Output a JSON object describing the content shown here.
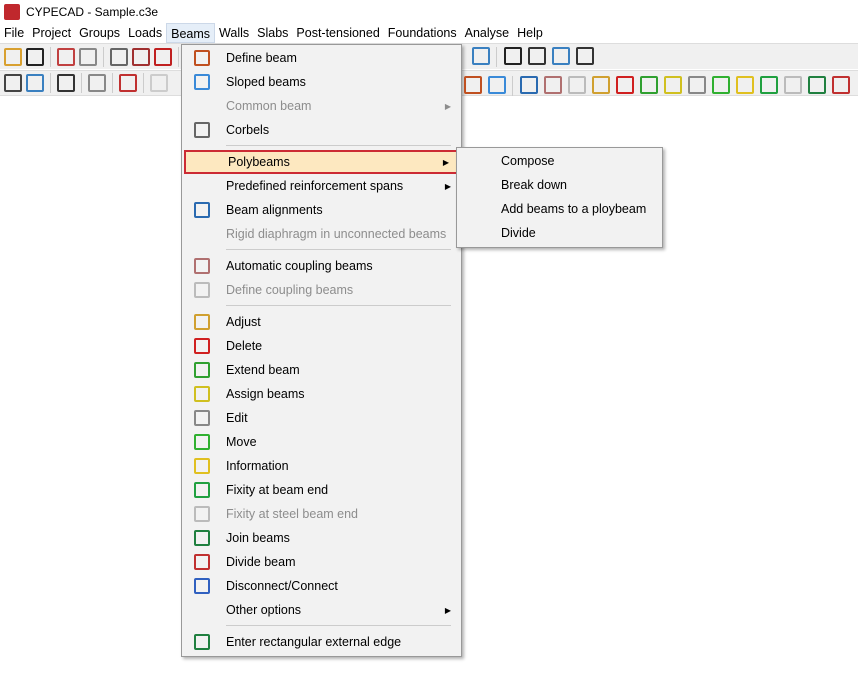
{
  "title": "CYPECAD - Sample.c3e",
  "menubar": [
    "File",
    "Project",
    "Groups",
    "Loads",
    "Beams",
    "Walls",
    "Slabs",
    "Post-tensioned",
    "Foundations",
    "Analyse",
    "Help"
  ],
  "beams_menu": [
    {
      "label": "Define beam",
      "icon": "define-beam-icon",
      "color": "#c05020"
    },
    {
      "label": "Sloped beams",
      "icon": "sloped-beam-icon",
      "color": "#3a8ad8"
    },
    {
      "label": "Common beam",
      "disabled": true,
      "submenu": true
    },
    {
      "label": "Corbels",
      "icon": "corbel-icon",
      "color": "#666666"
    },
    {
      "label": "Polybeams",
      "submenu": true,
      "highlighted": true
    },
    {
      "label": "Predefined reinforcement spans",
      "submenu": true
    },
    {
      "label": "Beam alignments",
      "icon": "beam-alignment-icon",
      "color": "#2a6ab0"
    },
    {
      "label": "Rigid diaphragm in unconnected beams",
      "disabled": true
    },
    {
      "label": "Automatic coupling beams",
      "icon": "coupling-icon",
      "color": "#b07070"
    },
    {
      "label": "Define coupling beams",
      "disabled": true,
      "icon": "define-coupling-icon",
      "color": "#bbbbbb"
    },
    {
      "label": "Adjust",
      "icon": "adjust-icon",
      "color": "#d0a030"
    },
    {
      "label": "Delete",
      "icon": "delete-icon",
      "color": "#d02020"
    },
    {
      "label": "Extend beam",
      "icon": "extend-icon",
      "color": "#30a030"
    },
    {
      "label": "Assign beams",
      "icon": "assign-icon",
      "color": "#d0c020"
    },
    {
      "label": "Edit",
      "icon": "edit-icon",
      "color": "#888888"
    },
    {
      "label": "Move",
      "icon": "move-icon",
      "color": "#30b030"
    },
    {
      "label": "Information",
      "icon": "information-icon",
      "color": "#e0c020"
    },
    {
      "label": "Fixity at beam end",
      "icon": "fixity-icon",
      "color": "#20a040"
    },
    {
      "label": "Fixity at steel beam end",
      "disabled": true,
      "icon": "steel-fixity-icon",
      "color": "#bbbbbb"
    },
    {
      "label": "Join beams",
      "icon": "join-icon",
      "color": "#208040"
    },
    {
      "label": "Divide beam",
      "icon": "divide-icon",
      "color": "#c03030"
    },
    {
      "label": "Disconnect/Connect",
      "icon": "disconnect-icon",
      "color": "#3060c0"
    },
    {
      "label": "Other options",
      "submenu": true
    },
    {
      "label": "Enter rectangular external edge",
      "icon": "external-edge-icon",
      "color": "#208040"
    }
  ],
  "polybeams_submenu": [
    "Compose",
    "Break down",
    "Add beams to a ploybeam",
    "Divide"
  ]
}
